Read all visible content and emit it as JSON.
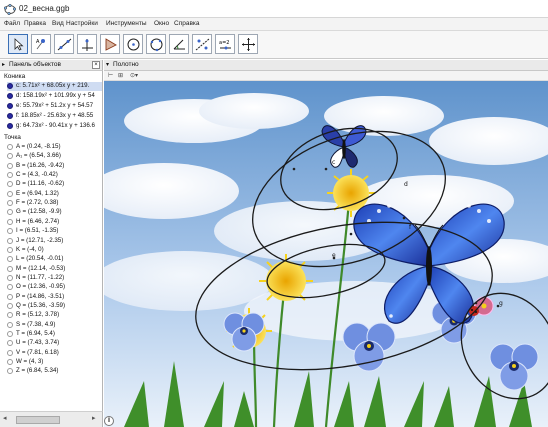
{
  "window": {
    "title": "02_весна.ggb"
  },
  "menu": [
    "Файл",
    "Правка",
    "Вид",
    "Настройки",
    "Инструменты",
    "Окно",
    "Справка"
  ],
  "toolbar": {
    "tools": [
      "move-tool",
      "point-tool",
      "line-tool",
      "perpendicular-tool",
      "polygon-tool",
      "circle-tool",
      "conic-tool",
      "angle-tool",
      "reflect-tool",
      "slider-tool",
      "move-graphics-tool"
    ],
    "slider_icon_text": "a=2"
  },
  "algebra": {
    "header": "Панель объектов",
    "sections": [
      {
        "title": "Коника",
        "items": [
          {
            "text": "c: 5.71x² + 68.05x y + 219.",
            "filled": true,
            "selected": true
          },
          {
            "text": "d: 158.19x² + 101.99x y + 54",
            "filled": true,
            "selected": false
          },
          {
            "text": "e: 55.79x² + 51.2x y + 54.57",
            "filled": true,
            "selected": false
          },
          {
            "text": "f: 18.85x² - 25.63x y + 48.55",
            "filled": true,
            "selected": false
          },
          {
            "text": "g: 64.73x² - 90.41x y + 136.6",
            "filled": true,
            "selected": false
          }
        ]
      },
      {
        "title": "Точка",
        "items": [
          {
            "text": "A = (0.24, -8.15)"
          },
          {
            "text": "A₁ = (6.54, 3.66)"
          },
          {
            "text": "B = (16.26, -9.42)"
          },
          {
            "text": "C = (4.3, -0.42)"
          },
          {
            "text": "D = (11.16, -0.62)"
          },
          {
            "text": "E = (6.94, 1.32)"
          },
          {
            "text": "F = (2.72, 0.38)"
          },
          {
            "text": "G = (12.58, -9.9)"
          },
          {
            "text": "H = (6.46, 2.74)"
          },
          {
            "text": "I = (6.51, -1.35)"
          },
          {
            "text": "J = (12.71, -2.35)"
          },
          {
            "text": "K = (-4, 0)"
          },
          {
            "text": "L = (20.54, -0.01)"
          },
          {
            "text": "M = (12.14, -0.53)"
          },
          {
            "text": "N = (11.77, -1.22)"
          },
          {
            "text": "O = (12.36, -0.95)"
          },
          {
            "text": "P = (14.86, -3.51)"
          },
          {
            "text": "Q = (15.36, -3.59)"
          },
          {
            "text": "R = (5.12, 3.78)"
          },
          {
            "text": "S = (7.38, 4.9)"
          },
          {
            "text": "T = (6.94, 5.4)"
          },
          {
            "text": "U = (7.43, 3.74)"
          },
          {
            "text": "V = (7.81, 6.18)"
          },
          {
            "text": "W = (4, 3)"
          },
          {
            "text": "Z = (6.84, 5.34)"
          }
        ]
      }
    ]
  },
  "graphics": {
    "header": "Полотно",
    "conic_labels": [
      "c",
      "d",
      "e",
      "f",
      "g"
    ]
  },
  "colors": {
    "sky_top": "#6d9ed3",
    "sky_bottom": "#dfeaf7",
    "butterfly_blue": "#2d5fd6",
    "petal_yellow": "#f3cf1b",
    "pansy_blue": "#6f8fe0",
    "grass": "#3f8f2a",
    "selection": "#cfdcf2"
  }
}
